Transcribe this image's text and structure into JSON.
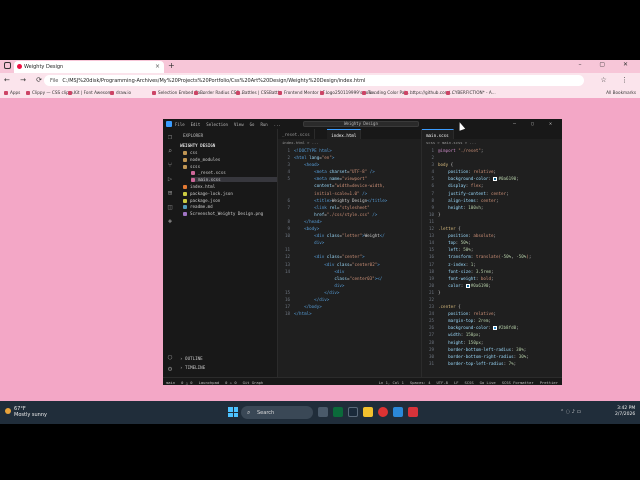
{
  "browser": {
    "tab_title": "Weighty Design",
    "url_prefix": "File",
    "url": "C:/MSJ%20disk/Programming-Archives/My%20Projects%20Portfolio/Css%20Art%20Design/Weighty%20Design/index.html",
    "bookmarks": [
      "Apps",
      "Clippy — CSS clip-p...",
      "Kit | Font Awesome",
      "draw.io",
      "Selection Embed Co...",
      "Border Radius CSS...",
      "Battles | CSSBattle",
      "Frontend Mentor | F...",
      "logo250119999's solu...",
      "Trending Color Pale...",
      "https://github.com/...",
      "CYBERFICTION* - A..."
    ],
    "all_bookmarks": "All Bookmarks"
  },
  "vscode": {
    "menus": [
      "File",
      "Edit",
      "Selection",
      "View",
      "Go",
      "Run",
      "..."
    ],
    "command_center": "Weighty Design",
    "explorer_header": "EXPLORER",
    "project": "WEIGHTY DESIGN",
    "files": [
      {
        "name": "css",
        "type": "folder"
      },
      {
        "name": "node_modules",
        "type": "folder"
      },
      {
        "name": "scss",
        "type": "folder"
      },
      {
        "name": "_reset.scss",
        "type": "scss"
      },
      {
        "name": "main.scss",
        "type": "scss"
      },
      {
        "name": "index.html",
        "type": "html"
      },
      {
        "name": "package-lock.json",
        "type": "json"
      },
      {
        "name": "package.json",
        "type": "json"
      },
      {
        "name": "readme.md",
        "type": "md"
      },
      {
        "name": "Screenshot_Weighty Design.png",
        "type": "png"
      }
    ],
    "outline_label": "OUTLINE",
    "timeline_label": "TIMELINE",
    "editor1_tabs": [
      "_reset.scss",
      "index.html"
    ],
    "editor1_breadcrumb": "index.html > ...",
    "editor1_lines": [
      {
        "n": "1",
        "html": "<span class=\"tag\">&lt;!DOCTYPE html&gt;</span>"
      },
      {
        "n": "2",
        "html": "<span class=\"tag\">&lt;html</span> <span class=\"attr\">lang</span>=<span class=\"str\">\"en\"</span><span class=\"tag\">&gt;</span>"
      },
      {
        "n": "3",
        "html": "    <span class=\"tag\">&lt;head&gt;</span>"
      },
      {
        "n": "4",
        "html": "        <span class=\"tag\">&lt;meta</span> <span class=\"attr\">charset</span>=<span class=\"str\">\"UTF-8\"</span> <span class=\"tag\">/&gt;</span>"
      },
      {
        "n": "5",
        "html": "        <span class=\"tag\">&lt;meta</span> <span class=\"attr\">name</span>=<span class=\"str\">\"viewport\"</span>"
      },
      {
        "n": "",
        "html": "        <span class=\"attr\">content</span>=<span class=\"str\">\"width=device-width,</span>"
      },
      {
        "n": "",
        "html": "        <span class=\"str\">initial-scale=1.0\"</span> <span class=\"tag\">/&gt;</span>"
      },
      {
        "n": "6",
        "html": "        <span class=\"tag\">&lt;title&gt;</span><span class=\"txt\">Weighty Design</span><span class=\"tag\">&lt;/title&gt;</span>"
      },
      {
        "n": "7",
        "html": "        <span class=\"tag\">&lt;link</span> <span class=\"attr\">rel</span>=<span class=\"str\">\"stylesheet\"</span>"
      },
      {
        "n": "",
        "html": "        <span class=\"attr\">href</span>=<span class=\"str\">\"./css/style.css\"</span> <span class=\"tag\">/&gt;</span>"
      },
      {
        "n": "8",
        "html": "    <span class=\"tag\">&lt;/head&gt;</span>"
      },
      {
        "n": "9",
        "html": "    <span class=\"tag\">&lt;body&gt;</span>"
      },
      {
        "n": "10",
        "html": "        <span class=\"tag\">&lt;div</span> <span class=\"attr\">class</span>=<span class=\"str\">\"letter\"</span><span class=\"tag\">&gt;</span><span class=\"txt\">Weight</span><span class=\"tag\">&lt;/</span>"
      },
      {
        "n": "",
        "html": "        <span class=\"tag\">div&gt;</span>"
      },
      {
        "n": "11",
        "html": ""
      },
      {
        "n": "12",
        "html": "        <span class=\"tag\">&lt;div</span> <span class=\"attr\">class</span>=<span class=\"str\">\"center\"</span><span class=\"tag\">&gt;</span>"
      },
      {
        "n": "13",
        "html": "            <span class=\"tag\">&lt;div</span> <span class=\"attr\">class</span>=<span class=\"str\">\"center02\"</span><span class=\"tag\">&gt;</span>"
      },
      {
        "n": "14",
        "html": "                <span class=\"tag\">&lt;div</span>"
      },
      {
        "n": "",
        "html": "                <span class=\"attr\">class</span>=<span class=\"str\">\"center03\"</span><span class=\"tag\">&gt;&lt;/</span>"
      },
      {
        "n": "",
        "html": "                <span class=\"tag\">div&gt;</span>"
      },
      {
        "n": "15",
        "html": "            <span class=\"tag\">&lt;/div&gt;</span>"
      },
      {
        "n": "16",
        "html": "        <span class=\"tag\">&lt;/div&gt;</span>"
      },
      {
        "n": "17",
        "html": "    <span class=\"tag\">&lt;/body&gt;</span>"
      },
      {
        "n": "18",
        "html": "<span class=\"tag\">&lt;/html&gt;</span>"
      }
    ],
    "editor2_tabs": [
      "main.scss"
    ],
    "editor2_breadcrumb": "scss > main.scss > ...",
    "editor2_lines": [
      {
        "n": "1",
        "html": "<span class=\"kw\">@import</span> <span class=\"val\">\"./reset\"</span>;"
      },
      {
        "n": "2",
        "html": ""
      },
      {
        "n": "3",
        "html": "<span class=\"sel-prop\">body</span> {"
      },
      {
        "n": "4",
        "html": "    <span class=\"prop\">position</span>: <span class=\"val\">relative</span>;"
      },
      {
        "n": "5",
        "html": "    <span class=\"prop\">background-color</span>: <span class=\"swatch\" style=\"background:#0a6190\"></span><span class=\"num\">#0a6190</span>;"
      },
      {
        "n": "6",
        "html": "    <span class=\"prop\">display</span>: <span class=\"val\">flex</span>;"
      },
      {
        "n": "7",
        "html": "    <span class=\"prop\">justify-content</span>: <span class=\"val\">center</span>;"
      },
      {
        "n": "8",
        "html": "    <span class=\"prop\">align-items</span>: <span class=\"val\">center</span>;"
      },
      {
        "n": "9",
        "html": "    <span class=\"prop\">height</span>: <span class=\"num\">100vh</span>;"
      },
      {
        "n": "10",
        "html": "}"
      },
      {
        "n": "11",
        "html": ""
      },
      {
        "n": "12",
        "html": "<span class=\"sel-prop\">.letter</span> {"
      },
      {
        "n": "13",
        "html": "    <span class=\"prop\">position</span>: <span class=\"val\">absolute</span>;"
      },
      {
        "n": "14",
        "html": "    <span class=\"prop\">top</span>: <span class=\"num\">50%</span>;"
      },
      {
        "n": "15",
        "html": "    <span class=\"prop\">left</span>: <span class=\"num\">50%</span>;"
      },
      {
        "n": "16",
        "html": "    <span class=\"prop\">transform</span>: <span class=\"val\">translate(</span><span class=\"num\">-50%</span>, <span class=\"num\">-50%</span><span class=\"val\">)</span>;"
      },
      {
        "n": "17",
        "html": "    <span class=\"prop\">z-index</span>: <span class=\"num\">1</span>;"
      },
      {
        "n": "18",
        "html": "    <span class=\"prop\">font-size</span>: <span class=\"num\">3.5rem</span>;"
      },
      {
        "n": "19",
        "html": "    <span class=\"prop\">font-weight</span>: <span class=\"val\">bold</span>;"
      },
      {
        "n": "20",
        "html": "    <span class=\"prop\">color</span>: <span class=\"swatch\" style=\"background:#0a6190\"></span><span class=\"num\">#0a6190</span>;"
      },
      {
        "n": "21",
        "html": "}"
      },
      {
        "n": "22",
        "html": ""
      },
      {
        "n": "23",
        "html": "<span class=\"sel-prop\">.center</span> {"
      },
      {
        "n": "24",
        "html": "    <span class=\"prop\">position</span>: <span class=\"val\">relative</span>;"
      },
      {
        "n": "25",
        "html": "    <span class=\"prop\">margin-top</span>: <span class=\"num\">2rem</span>;"
      },
      {
        "n": "26",
        "html": "    <span class=\"prop\">background-color</span>: <span class=\"swatch\" style=\"background:#2b8fd0\"></span><span class=\"num\">#2b8fd0</span>;"
      },
      {
        "n": "27",
        "html": "    <span class=\"prop\">width</span>: <span class=\"num\">150px</span>;"
      },
      {
        "n": "28",
        "html": "    <span class=\"prop\">height</span>: <span class=\"num\">150px</span>;"
      },
      {
        "n": "29",
        "html": "    <span class=\"prop\">border-bottom-left-radius</span>: <span class=\"num\">30%</span>;"
      },
      {
        "n": "30",
        "html": "    <span class=\"prop\">border-bottom-right-radius</span>: <span class=\"num\">30%</span>;"
      },
      {
        "n": "31",
        "html": "    <span class=\"prop\">border-top-left-radius</span>: <span class=\"num\">7%</span>;"
      }
    ],
    "status_left": [
      "main",
      "0 △ 0",
      "Launchpad",
      "0 ⚠ 0",
      "Git Graph"
    ],
    "status_right": [
      "Ln 1, Col 1",
      "Spaces: 4",
      "UTF-8",
      "LF",
      "SCSS",
      "Go Live",
      "SCSS Formatter",
      "Prettier"
    ]
  },
  "taskbar": {
    "temp": "67°F",
    "weather": "Mostly sunny",
    "search_placeholder": "Search",
    "time": "3:42 PM",
    "date": "2/7/2026"
  },
  "colors": {
    "page_background": "#f3a7c6",
    "accent": "#3b9cff"
  }
}
